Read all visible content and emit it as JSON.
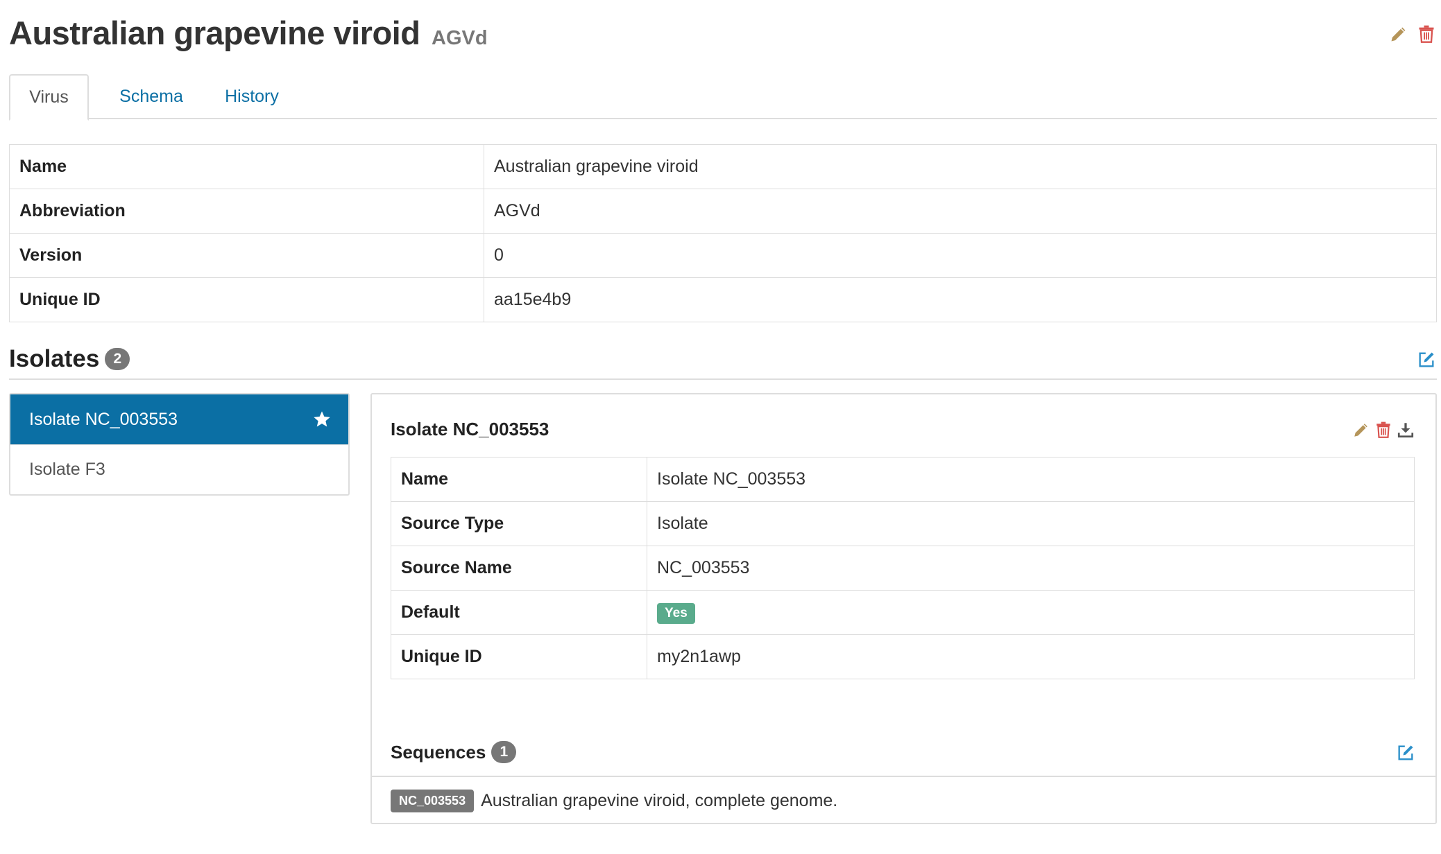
{
  "header": {
    "title": "Australian grapevine viroid",
    "abbreviation": "AGVd"
  },
  "tabs": [
    {
      "label": "Virus",
      "active": true
    },
    {
      "label": "Schema",
      "active": false
    },
    {
      "label": "History",
      "active": false
    }
  ],
  "virus_table": [
    {
      "key": "Name",
      "value": "Australian grapevine viroid"
    },
    {
      "key": "Abbreviation",
      "value": "AGVd"
    },
    {
      "key": "Version",
      "value": "0"
    },
    {
      "key": "Unique ID",
      "value": "aa15e4b9"
    }
  ],
  "isolates": {
    "title": "Isolates",
    "count": "2",
    "items": [
      {
        "label": "Isolate NC_003553",
        "active": true,
        "default": true
      },
      {
        "label": "Isolate F3",
        "active": false,
        "default": false
      }
    ]
  },
  "isolate_detail": {
    "title": "Isolate NC_003553",
    "rows": [
      {
        "key": "Name",
        "value": "Isolate NC_003553"
      },
      {
        "key": "Source Type",
        "value": "Isolate"
      },
      {
        "key": "Source Name",
        "value": "NC_003553"
      },
      {
        "key": "Default",
        "value": "Yes"
      },
      {
        "key": "Unique ID",
        "value": "my2n1awp"
      }
    ],
    "sequences": {
      "title": "Sequences",
      "count": "1",
      "items": [
        {
          "accession": "NC_003553",
          "definition": "Australian grapevine viroid, complete genome."
        }
      ]
    }
  },
  "icons": {
    "edit": "pencil-icon",
    "remove": "trash-icon",
    "download": "download-icon",
    "edit_square": "edit-square-icon",
    "default_marker": "star-icon"
  },
  "colors": {
    "primary": "#0b6fa4",
    "edit": "#b5955a",
    "danger": "#d9534f",
    "success": "#5aab8c",
    "badge": "#777777"
  }
}
